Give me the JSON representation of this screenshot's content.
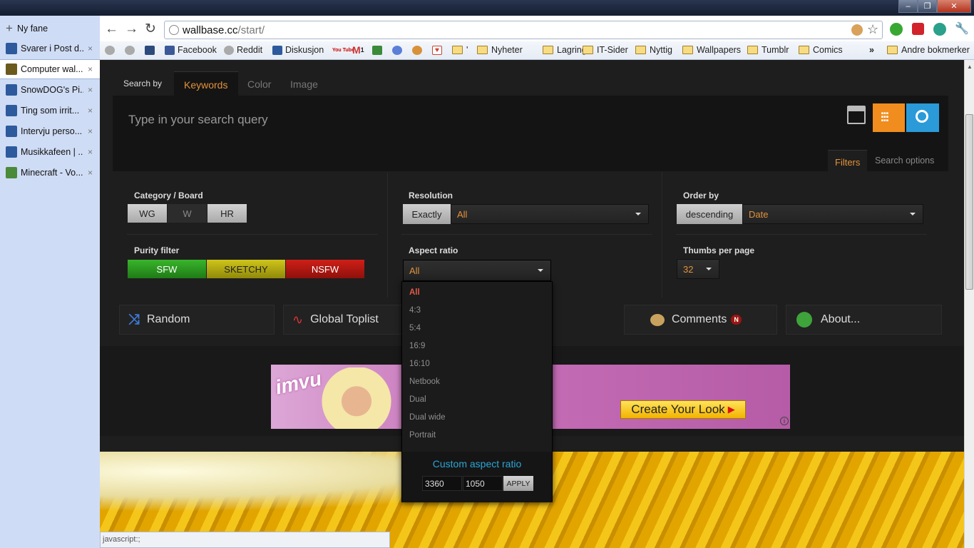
{
  "window": {
    "min_label": "–",
    "max_label": "❐",
    "close_label": "✕"
  },
  "side_tabs": {
    "new_tab": "Ny fane",
    "items": [
      {
        "label": "Svarer i Post d...",
        "color": "#2d5a9c"
      },
      {
        "label": "Computer wal...",
        "color": "#6b5a1e"
      },
      {
        "label": "SnowDOG's Pi...",
        "color": "#2d5a9c"
      },
      {
        "label": "Ting som irrit...",
        "color": "#2d5a9c"
      },
      {
        "label": "Intervju perso...",
        "color": "#2d5a9c"
      },
      {
        "label": "Musikkafeen | ...",
        "color": "#2d5a9c"
      },
      {
        "label": "Minecraft - Vo...",
        "color": "#4a8a3a"
      }
    ],
    "close_glyph": "×"
  },
  "toolbar": {
    "back_glyph": "←",
    "forward_glyph": "→",
    "reload_glyph": "↻",
    "url_domain": "wallbase.cc",
    "url_path": "/start/",
    "star_glyph": "☆",
    "wrench_glyph": "🔧"
  },
  "bookmarks": {
    "facebook": "Facebook",
    "reddit": "Reddit",
    "diskusjon": "Diskusjon",
    "youtube": "You Tube",
    "gmail_count": "1",
    "quote_folder": "'",
    "folders": [
      "Nyheter",
      "Lagring",
      "IT-Sider",
      "Nyttig",
      "Wallpapers",
      "Tumblr",
      "Comics"
    ],
    "overflow": "»",
    "other": "Andre bokmerker"
  },
  "search": {
    "search_by": "Search by",
    "tabs": [
      "Keywords",
      "Color",
      "Image"
    ],
    "placeholder": "Type in your search query",
    "filters_tab": "Filters",
    "options_tab": "Search options"
  },
  "filters": {
    "category_label": "Category / Board",
    "category_buttons": [
      "WG",
      "W",
      "HR"
    ],
    "purity_label": "Purity filter",
    "purity_buttons": [
      "SFW",
      "SKETCHY",
      "NSFW"
    ],
    "resolution_label": "Resolution",
    "resolution_mode": "Exactly",
    "resolution_value": "All",
    "aspect_label": "Aspect ratio",
    "aspect_value": "All",
    "order_label": "Order by",
    "order_dir": "descending",
    "order_value": "Date",
    "thumbs_label": "Thumbs per page",
    "thumbs_value": "32"
  },
  "aspect_dropdown": {
    "options": [
      "All",
      "4:3",
      "5:4",
      "16:9",
      "16:10",
      "Netbook",
      "Dual",
      "Dual wide",
      "Portrait"
    ],
    "custom_title": "Custom aspect ratio",
    "custom_w": "3360",
    "custom_h": "1050",
    "apply": "APPLY"
  },
  "nav": {
    "random": "Random",
    "toplist": "Global Toplist",
    "comments": "Comments",
    "comments_badge": "N",
    "about": "About..."
  },
  "ad": {
    "brand": "imvu",
    "cta": "Create Your Look",
    "info": "i"
  },
  "status_bar": "javascript:;",
  "colors": {
    "accent": "#e3923b",
    "sfw": "#2e9a22",
    "sketchy": "#b9b00d",
    "nsfw": "#b3160f",
    "custom": "#2aa6d6",
    "search_blue": "#2b9ad8"
  }
}
